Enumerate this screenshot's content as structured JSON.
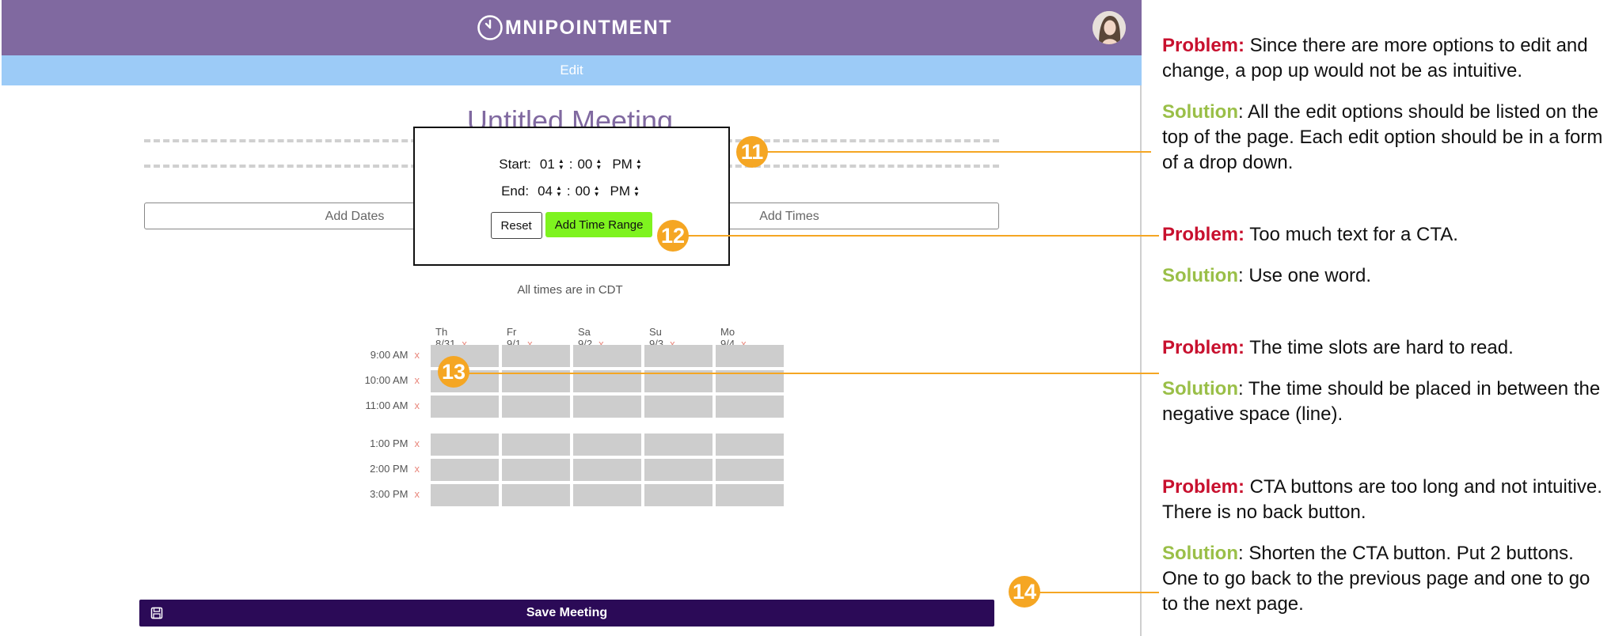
{
  "app": {
    "brand": "MNIPOINTMENT",
    "edit_bar": "Edit",
    "meeting_title": "Untitled Meeting",
    "add_dates": "Add Dates",
    "add_times": "Add Times",
    "timezone_note": "All times are in CDT",
    "save_label": "Save Meeting"
  },
  "popup": {
    "start_label": "Start:",
    "end_label": "End:",
    "start": {
      "hour": "01",
      "minute": "00",
      "ampm": "PM"
    },
    "end": {
      "hour": "04",
      "minute": "00",
      "ampm": "PM"
    },
    "colon": ":",
    "reset": "Reset",
    "add_range": "Add Time Range"
  },
  "grid": {
    "remove_symbol": "x",
    "days": [
      "Th 8/31",
      "Fr 9/1",
      "Sa 9/2",
      "Su 9/3",
      "Mo 9/4"
    ],
    "times": [
      "9:00 AM",
      "10:00 AM",
      "11:00 AM",
      "1:00 PM",
      "2:00 PM",
      "3:00 PM"
    ]
  },
  "markers": [
    "11",
    "12",
    "13",
    "14"
  ],
  "notes": [
    {
      "problem_label": "Problem:",
      "problem": " Since there are more options to edit and change, a pop up would not be as intuitive.",
      "solution_label": "Solution",
      "solution": ": All the edit options should be listed on the top of the page. Each edit option should be in a form of a drop down."
    },
    {
      "problem_label": "Problem:",
      "problem": " Too much text for a CTA.",
      "solution_label": "Solution",
      "solution": ": Use one word."
    },
    {
      "problem_label": "Problem:",
      "problem": " The time slots are hard to read.",
      "solution_label": "Solution",
      "solution": ": The time should be placed in between the negative space (line)."
    },
    {
      "problem_label": "Problem:",
      "problem": " CTA buttons are too long and not intuitive. There is no back button.",
      "solution_label": "Solution",
      "solution": ": Shorten the CTA button. Put 2 buttons. One to go back to the previous page and one to go to the next page."
    }
  ],
  "colors": {
    "header": "#8069a0",
    "edit_bar": "#9ccbf7",
    "save": "#2b0a57",
    "accent": "#f5a623",
    "problem": "#c8102e",
    "solution": "#9abf48",
    "add_range": "#7ef31f"
  }
}
